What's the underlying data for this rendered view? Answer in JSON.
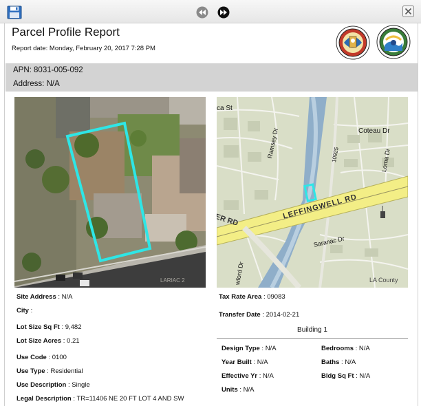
{
  "report": {
    "title": "Parcel Profile Report",
    "date": "Report date: Monday, February 20, 2017 7:28 PM"
  },
  "parcel": {
    "apn": "APN: 8031-005-092",
    "address": "Address: N/A"
  },
  "map": {
    "streets": [
      {
        "label": "ca St"
      },
      {
        "label": "Coteau Dr"
      },
      {
        "label": "Ramsey Dr"
      },
      {
        "label": "10925"
      },
      {
        "label": "Loma Dr"
      },
      {
        "label": "LEFFINGWELL RD"
      },
      {
        "label": "ER RD"
      },
      {
        "label": "Saranac Dr"
      },
      {
        "label": "wford Dr"
      }
    ],
    "credit": "LA County",
    "aerial_watermark": "LARIAC 2"
  },
  "details": {
    "site_address": {
      "label": "Site Address",
      "value": " : N/A"
    },
    "city": {
      "label": "City",
      "value": " :"
    },
    "lot_size_sqft": {
      "label": "Lot Size Sq Ft",
      "value": " : 9,482"
    },
    "lot_size_acres": {
      "label": "Lot Size Acres",
      "value": " : 0.21"
    },
    "use_code": {
      "label": "Use Code",
      "value": " : 0100"
    },
    "use_type": {
      "label": "Use Type",
      "value": " : Residential"
    },
    "use_description": {
      "label": "Use Description",
      "value": " : Single"
    },
    "legal_description": {
      "label": "Legal Description",
      "value": " : TR=11406 NE 20 FT LOT 4 AND SW"
    },
    "tax_rate_area": {
      "label": "Tax Rate Area",
      "value": " : 09083"
    },
    "transfer_date": {
      "label": "Transfer Date",
      "value": " : 2014-02-21"
    }
  },
  "building": {
    "title": "Building 1",
    "design_type": {
      "label": "Design Type",
      "value": " : N/A"
    },
    "year_built": {
      "label": "Year Built",
      "value": " : N/A"
    },
    "effective_yr": {
      "label": "Effective Yr",
      "value": " : N/A"
    },
    "units": {
      "label": "Units",
      "value": " : N/A"
    },
    "bedrooms": {
      "label": "Bedrooms",
      "value": " : N/A"
    },
    "baths": {
      "label": "Baths",
      "value": " : N/A"
    },
    "bldg_sq_ft": {
      "label": "Bldg Sq Ft",
      "value": " : N/A"
    }
  },
  "colors": {
    "parcel_highlight": "#2ee6e6",
    "header_band": "#d3d3d3",
    "road_yellow": "#f3ee86"
  },
  "icons": {
    "save": "floppy-disk-icon",
    "prev": "rewind-icon",
    "next": "fast-forward-icon",
    "close": "close-icon"
  }
}
